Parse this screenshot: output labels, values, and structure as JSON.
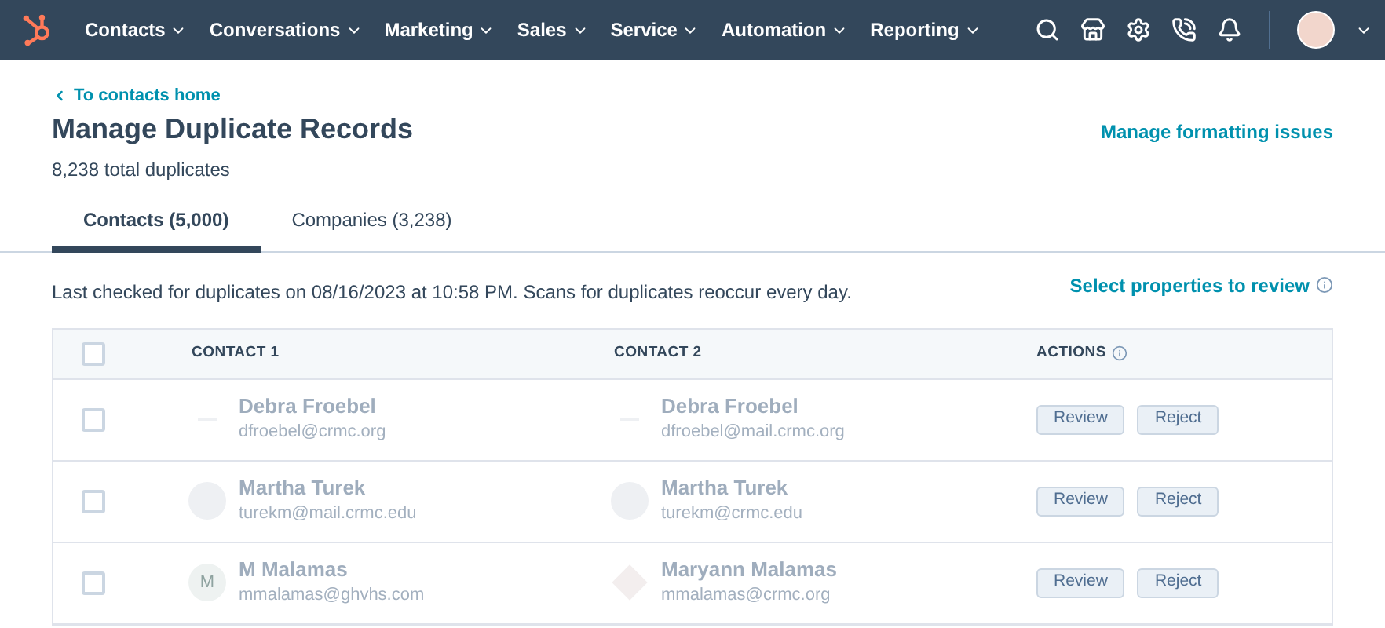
{
  "nav": {
    "items": [
      {
        "label": "Contacts"
      },
      {
        "label": "Conversations"
      },
      {
        "label": "Marketing"
      },
      {
        "label": "Sales"
      },
      {
        "label": "Service"
      },
      {
        "label": "Automation"
      },
      {
        "label": "Reporting"
      }
    ]
  },
  "back_link": "To contacts home",
  "title": "Manage Duplicate Records",
  "subtitle": "8,238 total duplicates",
  "formatting_link": "Manage formatting issues",
  "tabs": [
    {
      "label": "Contacts (5,000)",
      "selected": true
    },
    {
      "label": "Companies (3,238)",
      "selected": false
    }
  ],
  "status_text": "Last checked for duplicates on 08/16/2023 at 10:58 PM. Scans for duplicates reoccur every day.",
  "properties_link": "Select properties to review",
  "table": {
    "select_all": {
      "checked": false
    },
    "columns": [
      "CONTACT 1",
      "CONTACT 2",
      "ACTIONS"
    ],
    "rows": [
      {
        "checked": false,
        "contact_1": {
          "avatar": {
            "kind": "dash"
          },
          "name": "Debra Froebel",
          "email": "dfroebel@crmc.org"
        },
        "contact_2": {
          "avatar": {
            "kind": "dash"
          },
          "name": "Debra Froebel",
          "email": "dfroebel@mail.crmc.org"
        },
        "actions": [
          "Review",
          "Reject"
        ]
      },
      {
        "checked": false,
        "contact_1": {
          "avatar": {
            "kind": "logo"
          },
          "name": "Martha Turek",
          "email": "turekm@mail.crmc.edu"
        },
        "contact_2": {
          "avatar": {
            "kind": "logo"
          },
          "name": "Martha Turek",
          "email": "turekm@crmc.edu"
        },
        "actions": [
          "Review",
          "Reject"
        ]
      },
      {
        "checked": false,
        "contact_1": {
          "avatar": {
            "kind": "initial",
            "text": "M"
          },
          "name": "M Malamas",
          "email": "mmalamas@ghvhs.com"
        },
        "contact_2": {
          "avatar": {
            "kind": "diamond"
          },
          "name": "Maryann Malamas",
          "email": "mmalamas@crmc.org"
        },
        "actions": [
          "Review",
          "Reject"
        ]
      }
    ]
  }
}
